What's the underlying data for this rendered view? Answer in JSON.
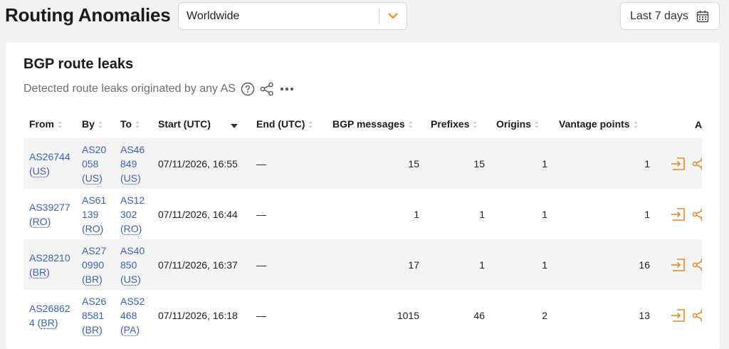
{
  "header": {
    "title": "Routing Anomalies",
    "region": "Worldwide",
    "date_range": "Last 7 days"
  },
  "card": {
    "title": "BGP route leaks",
    "description": "Detected route leaks originated by any AS"
  },
  "table": {
    "columns": [
      "From",
      "By",
      "To",
      "Start (UTC)",
      "End (UTC)",
      "BGP messages",
      "Prefixes",
      "Origins",
      "Vantage points",
      "A"
    ],
    "rows": [
      {
        "from_as": "AS26744",
        "from_cc": "US",
        "by_as": "AS20058",
        "by_cc": "US",
        "to_as": "AS46849",
        "to_cc": "US",
        "start": "07/11/2026, 16:55",
        "end": "—",
        "bgp_messages": "15",
        "prefixes": "15",
        "origins": "1",
        "vantage_points": "1"
      },
      {
        "from_as": "AS39277",
        "from_cc": "RO",
        "by_as": "AS61139",
        "by_cc": "RO",
        "to_as": "AS12302",
        "to_cc": "RO",
        "start": "07/11/2026, 16:44",
        "end": "—",
        "bgp_messages": "1",
        "prefixes": "1",
        "origins": "1",
        "vantage_points": "1"
      },
      {
        "from_as": "AS28210",
        "from_cc": "BR",
        "by_as": "AS270990",
        "by_cc": "BR",
        "to_as": "AS40850",
        "to_cc": "US",
        "start": "07/11/2026, 16:37",
        "end": "—",
        "bgp_messages": "17",
        "prefixes": "1",
        "origins": "1",
        "vantage_points": "16"
      },
      {
        "from_as": "AS268624",
        "from_cc": "BR",
        "by_as": "AS268581",
        "by_cc": "BR",
        "to_as": "AS52468",
        "to_cc": "PA",
        "start": "07/11/2026, 16:18",
        "end": "—",
        "bgp_messages": "1015",
        "prefixes": "46",
        "origins": "2",
        "vantage_points": "13"
      }
    ]
  },
  "icons": {
    "select_chevron": "chevron-down-icon",
    "date_picker": "calendar-icon",
    "help": "help-circle-icon",
    "share": "share-icon",
    "more": "more-horizontal-icon",
    "row_open": "open-in-icon",
    "row_share": "share-icon"
  },
  "colors": {
    "accent_orange": "#e8892a",
    "link_blue": "#3a63b8",
    "page_bg": "#f2f2f2",
    "row_stripe": "#f4f4f4"
  }
}
